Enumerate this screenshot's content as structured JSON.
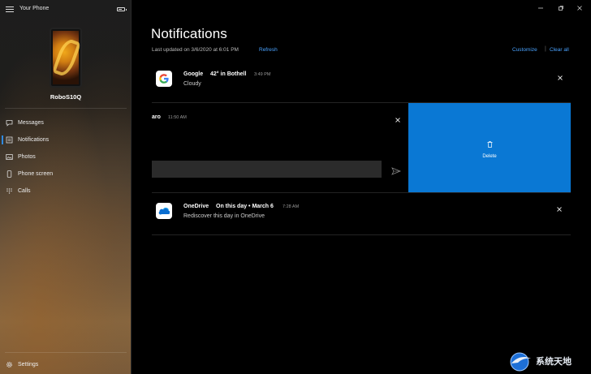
{
  "app": {
    "title": "Your Phone",
    "device_name": "RoboS10Q"
  },
  "sidebar": {
    "items": [
      {
        "label": "Messages",
        "icon": "chat-icon"
      },
      {
        "label": "Notifications",
        "icon": "notification-list-icon",
        "active": true
      },
      {
        "label": "Photos",
        "icon": "photo-icon"
      },
      {
        "label": "Phone screen",
        "icon": "phone-screen-icon"
      },
      {
        "label": "Calls",
        "icon": "dialpad-icon"
      }
    ],
    "settings_label": "Settings"
  },
  "main": {
    "title": "Notifications",
    "updated": "Last updated on 3/6/2020 at 6:01 PM",
    "refresh": "Refresh",
    "customize": "Customize",
    "separator": "|",
    "clear_all": "Clear all"
  },
  "notifications": [
    {
      "app": "Google",
      "title": "42° in Bothell",
      "time": "3:49 PM",
      "body": "Cloudy"
    },
    {
      "app": "aro",
      "time": "11:50 AM",
      "delete_label": "Delete"
    },
    {
      "app": "OneDrive",
      "title": "On this day • March 6",
      "time": "7:28 AM",
      "body": "Rediscover this day in OneDrive"
    }
  ],
  "watermark": {
    "text": "系统天地"
  },
  "colors": {
    "accent": "#0a78d4",
    "link": "#4aa3ff",
    "background": "#000000"
  }
}
